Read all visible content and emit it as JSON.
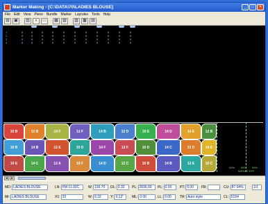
{
  "window": {
    "title": "Marker Making - [C:\\DATA\\70\\LADIES BLOUSE]"
  },
  "menu": [
    "File",
    "Edit",
    "View",
    "Piece",
    "Bundle",
    "Marker",
    "Layrules",
    "Tools",
    "Help"
  ],
  "toolbar_icons": [
    "open-icon",
    "save-icon",
    "print-icon",
    "zoom-icon",
    "fit-icon",
    "grid-icon",
    "ruler-icon",
    "marker-icon",
    "bundle-icon",
    "layout-icon"
  ],
  "piece_list": {
    "rows": [
      [
        "1",
        "0",
        "0",
        "0",
        "0",
        "0",
        "0",
        "0",
        "0",
        "0",
        "0",
        "0"
      ],
      [
        "2",
        "0",
        "0",
        "0",
        "0",
        "0",
        "0",
        "0",
        "0",
        "0",
        "0",
        "0"
      ],
      [
        "3",
        "0",
        "0",
        "0",
        "0",
        "0",
        "0",
        "0",
        "0",
        "0",
        "0",
        "0"
      ],
      [
        "4",
        "0",
        "0",
        "0",
        "0",
        "0",
        "0",
        "0",
        "0",
        "0",
        "0",
        "0"
      ]
    ]
  },
  "marker_pieces": [
    {
      "label": "10 B",
      "color": "#d9453b"
    },
    {
      "label": "12 B",
      "color": "#e0812c"
    },
    {
      "label": "14 F",
      "color": "#a8b545"
    },
    {
      "label": "12 F",
      "color": "#6f5fc1"
    },
    {
      "label": "14 B",
      "color": "#2f9dbd"
    },
    {
      "label": "12 D",
      "color": "#4a7fd0"
    },
    {
      "label": "10 E",
      "color": "#38b04e"
    },
    {
      "label": "14 D",
      "color": "#c04d9a"
    },
    {
      "label": "14 E",
      "color": "#e2a12a"
    },
    {
      "label": "12 B",
      "color": "#4a8f3c"
    },
    {
      "label": "10 B",
      "color": "#3f9fd6"
    },
    {
      "label": "14 B",
      "color": "#6b56b8"
    },
    {
      "label": "12 E",
      "color": "#d2532e"
    },
    {
      "label": "10 D",
      "color": "#2ea59b"
    },
    {
      "label": "14 F",
      "color": "#9b46a8"
    },
    {
      "label": "12 F",
      "color": "#c94c54"
    },
    {
      "label": "10 D",
      "color": "#4f8f39"
    },
    {
      "label": "14 C",
      "color": "#3a68c8"
    },
    {
      "label": "12 D",
      "color": "#dd7d2c"
    },
    {
      "label": "14 E",
      "color": "#e0b32b"
    },
    {
      "label": "10 E",
      "color": "#c14a45"
    },
    {
      "label": "14 C",
      "color": "#4ba54a"
    },
    {
      "label": "12 A",
      "color": "#8752b0"
    },
    {
      "label": "10 F",
      "color": "#d88a3a"
    },
    {
      "label": "14 D",
      "color": "#3b8ecf"
    },
    {
      "label": "12 C",
      "color": "#58a648"
    },
    {
      "label": "10 B",
      "color": "#cf4d3a"
    },
    {
      "label": "14 B",
      "color": "#5c5cc0"
    },
    {
      "label": "12 E",
      "color": "#2da8a0"
    },
    {
      "label": "10 C",
      "color": "#b7a83a"
    }
  ],
  "marker_labels": {
    "right_a": "99%",
    "right_b": "95%",
    "right_c": "99%",
    "right_d": "TARGET EFF"
  },
  "status": {
    "md_label": "MD:",
    "md_value": "LADIES BLOUSE",
    "ln_label": "LN:",
    "ln_value": "FM 11.92C",
    "w_label": "W:",
    "w_value": "136.70",
    "dl_label": "DL:",
    "dl_value": "0.32",
    "pl_label": "PL:",
    "pl_value": "2836.00",
    "pl2_label": "PL:",
    "pl2_value": "0.00",
    "pt_label": "PT:",
    "pt_value": "0.00",
    "fb_label": "FB:",
    "fb_value": "",
    "cu_label": "CU:",
    "cu_value": "87.04%",
    "page": "1/1",
    "md2_label": "Mr:",
    "md2_value": "LADIES BLOUSE",
    "x_label": "X1:",
    "x_value": "33",
    "w2_label": "W:",
    "w2_value": "0.32",
    "y_label": "Y:",
    "y_value": "0.13\"",
    "ml_label": "ML:",
    "ml_value": "0.00",
    "ll_label": "LL:",
    "ll_value": "0.00",
    "tr_label": "TR:",
    "tr_value": "Auto style",
    "cl_label": "CL:",
    "cl_value": "5154"
  }
}
